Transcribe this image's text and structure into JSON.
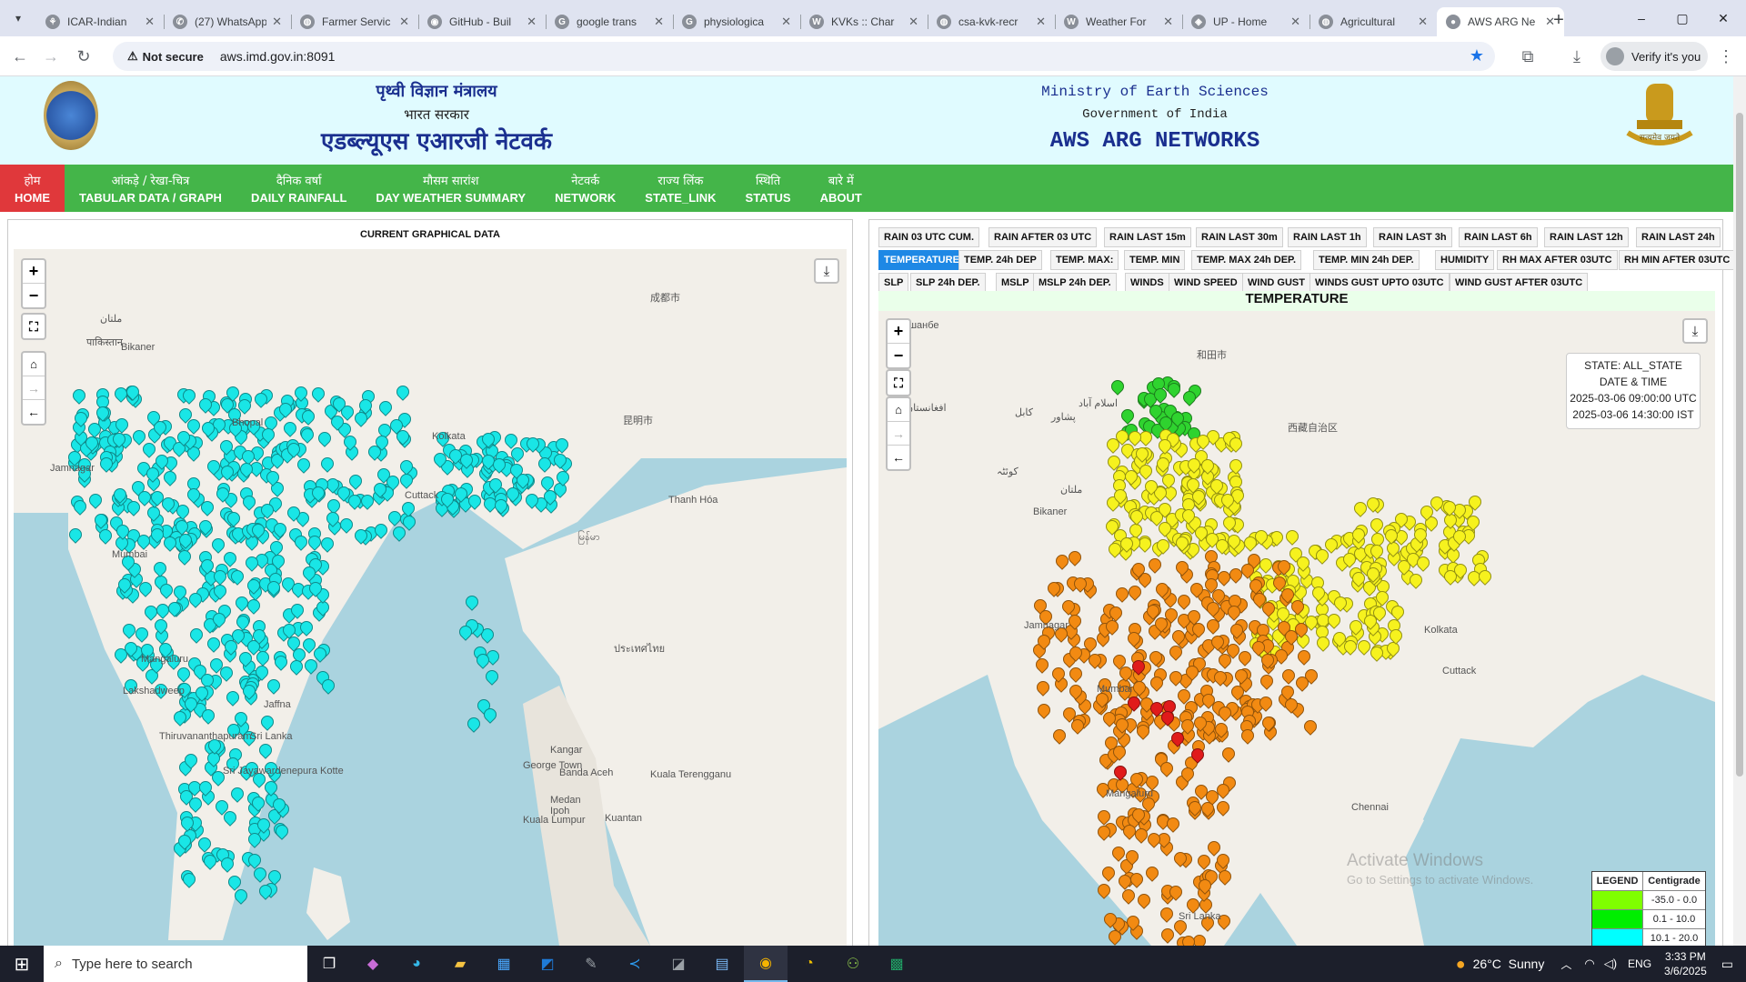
{
  "browser": {
    "tabs": [
      {
        "label": "ICAR-Indian",
        "icon": "icar-icon",
        "icon_glyph": "⚘"
      },
      {
        "label": "(27) WhatsApp",
        "icon": "whatsapp-icon",
        "icon_glyph": "✆"
      },
      {
        "label": "Farmer Servic",
        "icon": "globe-icon",
        "icon_glyph": "◍"
      },
      {
        "label": "GitHub - Buil",
        "icon": "github-icon",
        "icon_glyph": "◉"
      },
      {
        "label": "google trans",
        "icon": "google-icon",
        "icon_glyph": "G"
      },
      {
        "label": "physiologica",
        "icon": "google-icon",
        "icon_glyph": "G"
      },
      {
        "label": "KVKs :: Char",
        "icon": "wordpress-icon",
        "icon_glyph": "W"
      },
      {
        "label": "csa-kvk-recr",
        "icon": "globe-icon",
        "icon_glyph": "◍"
      },
      {
        "label": "Weather For",
        "icon": "wordpress-icon",
        "icon_glyph": "W"
      },
      {
        "label": "UP - Home",
        "icon": "up-icon",
        "icon_glyph": "◈"
      },
      {
        "label": "Agricultural",
        "icon": "globe-icon",
        "icon_glyph": "◍"
      },
      {
        "label": "AWS ARG Ne",
        "icon": "imd-icon",
        "icon_glyph": "●"
      }
    ],
    "new_tab": "+",
    "window_controls": [
      "–",
      "▢",
      "✕"
    ],
    "address": {
      "security": "Not secure",
      "url": "aws.imd.gov.in:8091"
    },
    "verify_label": "Verify it's you"
  },
  "header": {
    "hindi_ministry": "पृथ्वी विज्ञान मंत्रालय",
    "hindi_govt": "भारत सरकार",
    "hindi_title": "एडब्ल्यूएस एआरजी नेटवर्क",
    "en_ministry": "Ministry of Earth Sciences",
    "en_govt": "Government of India",
    "en_title": "AWS ARG NETWORKS",
    "emblem_motto": "सत्यमेव जयते"
  },
  "nav": [
    {
      "hindi": "होम",
      "english": "HOME",
      "active": true
    },
    {
      "hindi": "आंकड़े / रेखा-चित्र",
      "english": "TABULAR DATA / GRAPH",
      "active": false
    },
    {
      "hindi": "दैनिक वर्षा",
      "english": "DAILY RAINFALL",
      "active": false
    },
    {
      "hindi": "मौसम सारांश",
      "english": "DAY WEATHER SUMMARY",
      "active": false
    },
    {
      "hindi": "नेटवर्क",
      "english": "NETWORK",
      "active": false
    },
    {
      "hindi": "राज्य लिंक",
      "english": "STATE_LINK",
      "active": false
    },
    {
      "hindi": "स्थिति",
      "english": "STATUS",
      "active": false
    },
    {
      "hindi": "बारे में",
      "english": "ABOUT",
      "active": false
    }
  ],
  "left_panel": {
    "title": "CURRENT GRAPHICAL DATA",
    "places": [
      "पाकिस्तान",
      "ملتان",
      "Bikaner",
      "Jamnagar",
      "Mumbai",
      "Mangaluru",
      "Lakshadweep",
      "Thiruvananthapuram",
      "Jaffna",
      "Sri Lanka",
      "Sri Jayawardenepura Kotte",
      "Bhopal",
      "Cuttack",
      "Kolkata",
      "Banda Aceh",
      "Medan",
      "George Town",
      "Ipoh",
      "Kuala Terengganu",
      "Kuala Lumpur",
      "Kuantan",
      "Kangar",
      "成都市",
      "昆明市",
      "Thanh Hóa",
      "ประเทศไทย",
      "မြန်မာ"
    ]
  },
  "right_panel": {
    "param_rows": [
      [
        "RAIN 03 UTC CUM.",
        "RAIN AFTER 03 UTC",
        "RAIN LAST 15m",
        "RAIN LAST 30m",
        "RAIN LAST 1h",
        "RAIN LAST 3h",
        "RAIN LAST 6h",
        "RAIN LAST 12h",
        "RAIN LAST 24h"
      ],
      [
        "TEMPERATURE",
        "TEMP. 24h DEP",
        "TEMP. MAX:",
        "TEMP. MIN",
        "TEMP. MAX 24h DEP.",
        "TEMP. MIN 24h DEP.",
        "HUMIDITY",
        "RH MAX AFTER 03UTC",
        "RH MIN AFTER 03UTC"
      ],
      [
        "SLP",
        "SLP 24h DEP.",
        "MSLP",
        "MSLP 24h DEP.",
        "WINDS",
        "WIND SPEED",
        "WIND GUST",
        "WINDS GUST UPTO 03UTC",
        "WIND GUST AFTER 03UTC"
      ]
    ],
    "active_param": "TEMPERATURE",
    "map_title": "TEMPERATURE",
    "info": {
      "state": "STATE: ALL_STATE",
      "dt_label": "DATE & TIME",
      "utc": "2025-03-06 09:00:00 UTC",
      "ist": "2025-03-06 14:30:00 IST"
    },
    "places": [
      "Душанбе",
      "افغانستان",
      "کابل",
      "پشاور",
      "اسلام آباد",
      "کوئٹہ",
      "ملتان",
      "Bikaner",
      "Jamnagar",
      "Mumbai",
      "Mangaluru",
      "Cuttack",
      "Kolkata",
      "Chennai",
      "Sri Lanka",
      "西藏自治区",
      "和田市"
    ],
    "watermark": [
      "Activate Windows",
      "Go to Settings to activate Windows."
    ],
    "legend": {
      "headers": [
        "LEGEND",
        "Centigrade"
      ],
      "rows": [
        {
          "color": "#7fff00",
          "range": "-35.0 - 0.0"
        },
        {
          "color": "#00ee00",
          "range": "0.1 - 10.0"
        },
        {
          "color": "#00ffff",
          "range": "10.1 - 20.0"
        }
      ]
    }
  },
  "taskbar": {
    "search_placeholder": "Type here to search",
    "weather": "26°C  Sunny",
    "lang": "ENG",
    "time": "3:33 PM",
    "date": "3/6/2025"
  },
  "colors": {
    "nav_green": "#44b549",
    "nav_active": "#e0383b",
    "header_bg": "#e0fbff",
    "header_text": "#1a2f8f",
    "marker_cyan": "#19e6e6",
    "marker_orange": "#f28a12",
    "marker_yellow": "#f6f21e",
    "marker_green": "#2fd32f",
    "marker_red": "#e01b1b"
  }
}
